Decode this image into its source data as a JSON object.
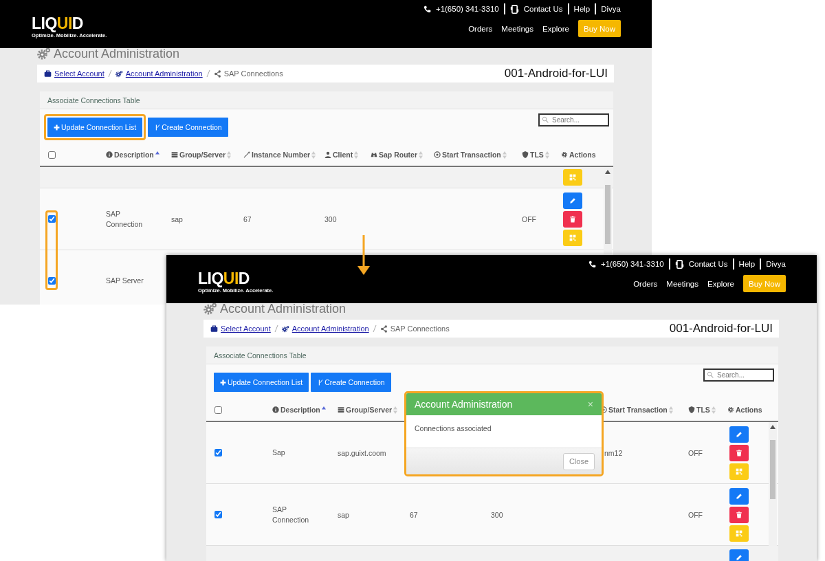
{
  "screens": [
    {
      "header": {
        "logo": [
          {
            "text": "LIQ",
            "accent": false
          },
          {
            "text": "UI",
            "accent": true
          },
          {
            "text": "D",
            "accent": false
          }
        ],
        "tagline": "Optimize. Mobilize. Accelerate.",
        "phone": "+1(650) 341-3310",
        "contact": "Contact Us",
        "help": "Help",
        "user": "Divya",
        "nav": [
          "Orders",
          "Meetings",
          "Explore"
        ],
        "buy": "Buy Now"
      },
      "title": "Account Administration",
      "breadcrumb": [
        {
          "label": "Select Account",
          "link": true
        },
        {
          "label": "Account Administration",
          "link": true
        },
        {
          "label": "SAP Connections",
          "link": false
        }
      ],
      "account": "001-Android-for-LUI",
      "card_title": "Associate Connections Table",
      "buttons": [
        {
          "label": "Update Connection List",
          "highlighted": true
        },
        {
          "label": "Create Connection",
          "highlighted": false
        }
      ],
      "search": {
        "placeholder": "Search..."
      },
      "table": {
        "columns": [
          {
            "kind": "checkbox",
            "checked": false
          },
          {
            "kind": "label",
            "label": "Description",
            "sorted": true
          },
          {
            "kind": "label",
            "label": "Group/Server",
            "sorted": false
          },
          {
            "kind": "label",
            "label": "Instance Number",
            "sorted": false
          },
          {
            "kind": "label",
            "label": "Client",
            "sorted": false
          },
          {
            "kind": "label",
            "label": "Sap Router",
            "sorted": false
          },
          {
            "kind": "label",
            "label": "Start Transaction",
            "sorted": false
          },
          {
            "kind": "label",
            "label": "TLS",
            "sorted": false
          },
          {
            "kind": "label",
            "label": "Actions"
          }
        ],
        "rows": [
          {
            "kind": "clipped",
            "actions": [
              {
                "kind": "qr"
              }
            ]
          },
          {
            "kind": "full",
            "checked": true,
            "highlighted": true,
            "cells": [
              "SAP Connection",
              "sap",
              "67",
              "300",
              null,
              null,
              "OFF"
            ],
            "actions": [
              {
                "kind": "edit"
              },
              {
                "kind": "delete"
              },
              {
                "kind": "qr"
              }
            ]
          },
          {
            "kind": "full",
            "checked": true,
            "highlighted": true,
            "cells": [
              "SAP Server"
            ]
          }
        ]
      }
    },
    {
      "header": {
        "logo": [
          {
            "text": "LIQ",
            "accent": false
          },
          {
            "text": "UI",
            "accent": true
          },
          {
            "text": "D",
            "accent": false
          }
        ],
        "tagline": "Optimize. Mobilize. Accelerate.",
        "phone": "+1(650) 341-3310",
        "contact": "Contact Us",
        "help": "Help",
        "user": "Divya",
        "nav": [
          "Orders",
          "Meetings",
          "Explore"
        ],
        "buy": "Buy Now"
      },
      "title": "Account Administration",
      "breadcrumb": [
        {
          "label": "Select Account",
          "link": true
        },
        {
          "label": "Account Administration",
          "link": true
        },
        {
          "label": "SAP Connections",
          "link": false
        }
      ],
      "account": "001-Android-for-LUI",
      "card_title": "Associate Connections Table",
      "buttons": [
        {
          "label": "Update Connection List",
          "highlighted": false
        },
        {
          "label": "Create Connection",
          "highlighted": false
        }
      ],
      "search": {
        "placeholder": "Search..."
      },
      "table": {
        "columns": [
          {
            "kind": "checkbox",
            "checked": false
          },
          {
            "kind": "label",
            "label": "Description",
            "sorted": true
          },
          {
            "kind": "label",
            "label": "Group/Server",
            "sorted": false
          },
          null,
          null,
          null,
          {
            "kind": "label",
            "label": "Start Transaction",
            "sorted": false
          },
          {
            "kind": "label",
            "label": "TLS",
            "sorted": false
          },
          {
            "kind": "label",
            "label": "Actions"
          }
        ],
        "rows": [
          {
            "kind": "full",
            "checked": true,
            "highlighted": false,
            "cells": [
              "Sap",
              "sap.guixt.coom",
              null,
              null,
              null,
              "nm12",
              "OFF"
            ],
            "actions": [
              {
                "kind": "edit"
              },
              {
                "kind": "delete"
              },
              {
                "kind": "qr"
              }
            ]
          },
          {
            "kind": "full",
            "checked": true,
            "highlighted": false,
            "cells": [
              "SAP Connection",
              "sap",
              "67",
              "300",
              null,
              null,
              "OFF"
            ],
            "actions": [
              {
                "kind": "edit"
              },
              {
                "kind": "delete"
              },
              {
                "kind": "qr"
              }
            ]
          },
          {
            "kind": "clipped",
            "actions": [
              {
                "kind": "edit"
              }
            ]
          }
        ]
      },
      "dialog": {
        "title": "Account Administration",
        "close_icon": "×",
        "message": "Connections associated",
        "button": "Close",
        "highlighted": true
      }
    }
  ]
}
